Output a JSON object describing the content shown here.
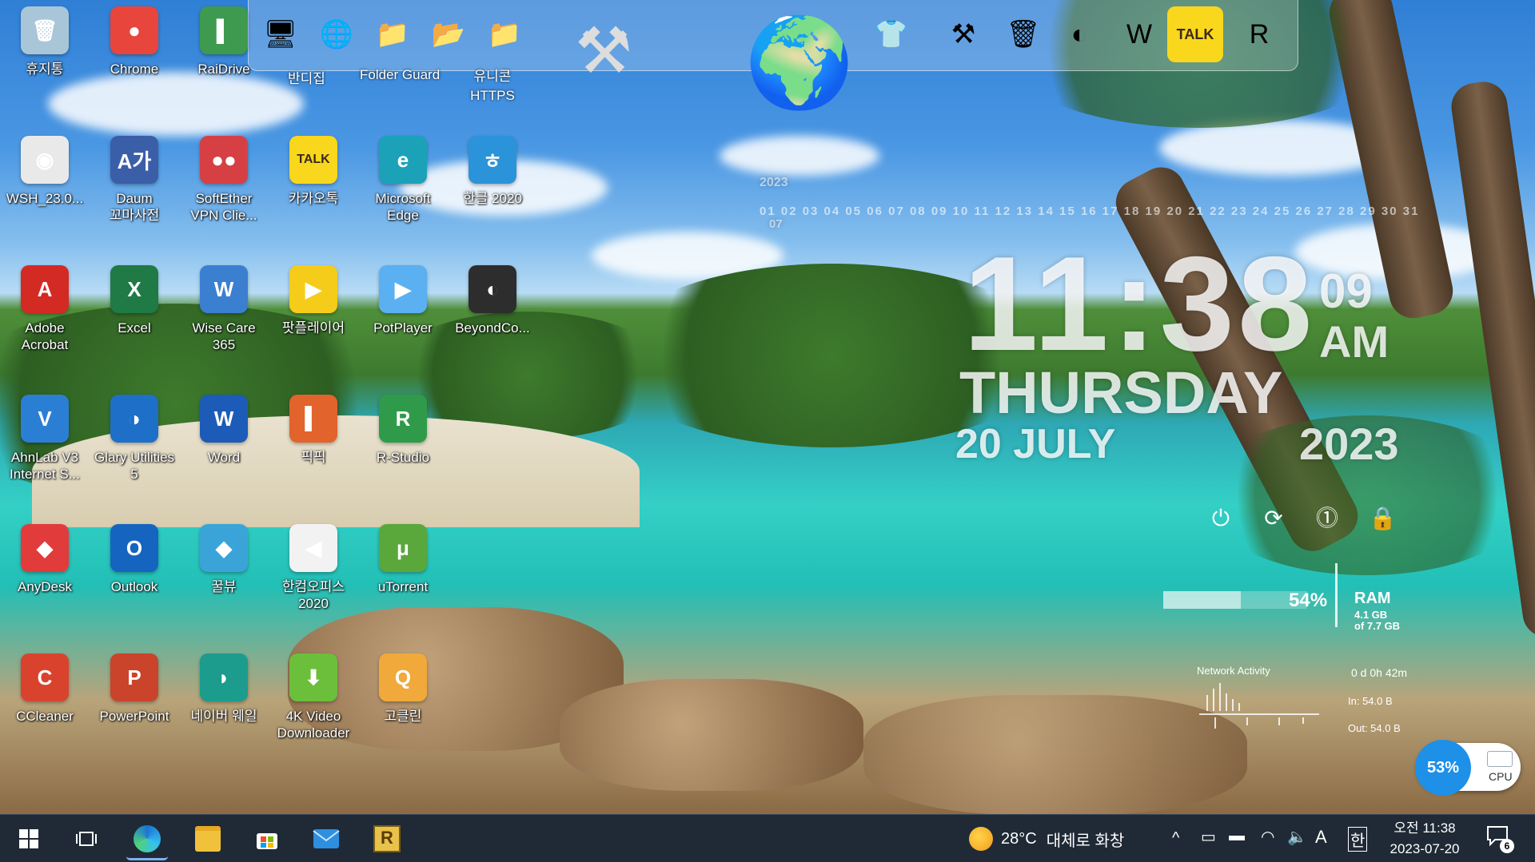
{
  "desktop": {
    "icons": [
      {
        "label": "휴지통",
        "glyph": "🗑",
        "color": "#a8c6d8"
      },
      {
        "label": "Chrome",
        "glyph": "●",
        "color": "#e8453c"
      },
      {
        "label": "RaiDrive",
        "glyph": "▌",
        "color": "#3e9a4e"
      },
      {
        "label": "WSH_23.0...",
        "glyph": "◉",
        "color": "#e9e9e9"
      },
      {
        "label": "Daum 꼬마사전",
        "glyph": "A가",
        "color": "#3b5ea8"
      },
      {
        "label": "SoftEther VPN Clie...",
        "glyph": "●●",
        "color": "#d64045"
      },
      {
        "label": "카카오톡",
        "glyph": "TALK",
        "color": "#f9d71c"
      },
      {
        "label": "Microsoft Edge",
        "glyph": "e",
        "color": "#1ba2b8"
      },
      {
        "label": "한글 2020",
        "glyph": "ㅎ",
        "color": "#2b93d9"
      },
      {
        "label": "Adobe Acrobat",
        "glyph": "A",
        "color": "#d42a24"
      },
      {
        "label": "Excel",
        "glyph": "X",
        "color": "#1f7a45"
      },
      {
        "label": "Wise Care 365",
        "glyph": "W",
        "color": "#3b7fd1"
      },
      {
        "label": "팟플레이어",
        "glyph": "▶",
        "color": "#f5cc1a"
      },
      {
        "label": "PotPlayer",
        "glyph": "▶",
        "color": "#5ab0f0"
      },
      {
        "label": "BeyondCo...",
        "glyph": "◐",
        "color": "#2d2d2d"
      },
      {
        "label": "AhnLab V3 Internet S...",
        "glyph": "V",
        "color": "#2a7fd4"
      },
      {
        "label": "Glary Utilities 5",
        "glyph": "◑",
        "color": "#1e6fc8"
      },
      {
        "label": "Word",
        "glyph": "W",
        "color": "#1d5bb8"
      },
      {
        "label": "픽픽",
        "glyph": "▍",
        "color": "#e2632c"
      },
      {
        "label": "R-Studio",
        "glyph": "R",
        "color": "#2f9b4a"
      },
      {
        "label": "AnyDesk",
        "glyph": "◆",
        "color": "#e23b3b"
      },
      {
        "label": "Outlook",
        "glyph": "O",
        "color": "#1565c0"
      },
      {
        "label": "꿀뷰",
        "glyph": "◆",
        "color": "#3aa4d8"
      },
      {
        "label": "한컴오피스 2020",
        "glyph": "◀",
        "color": "#f2f2f2"
      },
      {
        "label": "uTorrent",
        "glyph": "μ",
        "color": "#5aa73b"
      },
      {
        "label": "CCleaner",
        "glyph": "C",
        "color": "#d9432e"
      },
      {
        "label": "PowerPoint",
        "glyph": "P",
        "color": "#c9442a"
      },
      {
        "label": "네이버 웨일",
        "glyph": "◗",
        "color": "#1b9c8c"
      },
      {
        "label": "4K Video Downloader",
        "glyph": "⬇",
        "color": "#6cbf3b"
      },
      {
        "label": "고클린",
        "glyph": "Q",
        "color": "#f0a93a"
      }
    ]
  },
  "dock": {
    "labels": [
      "반디집",
      "Folder Guard",
      "유니콘 HTTPS"
    ],
    "items": [
      {
        "name": "network-app-icon",
        "glyph": "🖥"
      },
      {
        "name": "network-app-icon",
        "glyph": "🌐"
      },
      {
        "name": "folder-icon",
        "glyph": "📁"
      },
      {
        "name": "folder-icon",
        "glyph": "📂"
      },
      {
        "name": "folder-icon",
        "glyph": "📁"
      },
      {
        "name": "tools-icon",
        "glyph": "⚒"
      },
      {
        "name": "globe-icon",
        "glyph": "🌍"
      },
      {
        "name": "tshirt-icon",
        "glyph": "👕"
      },
      {
        "name": "hammer-icon",
        "glyph": "⚒"
      },
      {
        "name": "recycle-bin-icon",
        "glyph": "🗑"
      },
      {
        "name": "glary-icon",
        "glyph": "◐"
      },
      {
        "name": "wise-care-icon",
        "glyph": "W"
      },
      {
        "name": "kakaotalk-icon",
        "glyph": "TALK"
      },
      {
        "name": "registry-icon",
        "glyph": "R"
      }
    ]
  },
  "clock": {
    "year_small": "2023",
    "month_small": "07",
    "days_row": "01 02 03 04 05 06 07 08 09 10 11 12 13 14 15 16 17 18 19 20 21 22 23 24 25 26 27 28 29 30 31",
    "time": "11:38",
    "seconds": "09",
    "ampm": "AM",
    "weekday": "THURSDAY",
    "date": "20 JULY",
    "year": "2023"
  },
  "power": {
    "buttons": [
      "⏻",
      "⟳",
      "⓵",
      "🔒"
    ]
  },
  "ram": {
    "percent": "54%",
    "title": "RAM",
    "used": "4.1 GB",
    "total": "of 7.7 GB",
    "level": 0.54
  },
  "network": {
    "title": "Network Activity",
    "uptime": "0 d 0h 42m",
    "in": "In: 54.0 B",
    "out": "Out: 54.0 B"
  },
  "cpu": {
    "percent": "53%",
    "label": "CPU"
  },
  "taskbar": {
    "weather_temp": "28°C",
    "weather_text": "대체로 화창",
    "clock_ampm_time": "오전 11:38",
    "date": "2023-07-20",
    "ime_mode": "A",
    "ime_lang": "한",
    "notif_count": "6",
    "chevron": "^"
  },
  "colors": {
    "taskbar_bg": "#1f2a36",
    "cpu_accent": "#1e90e8"
  }
}
